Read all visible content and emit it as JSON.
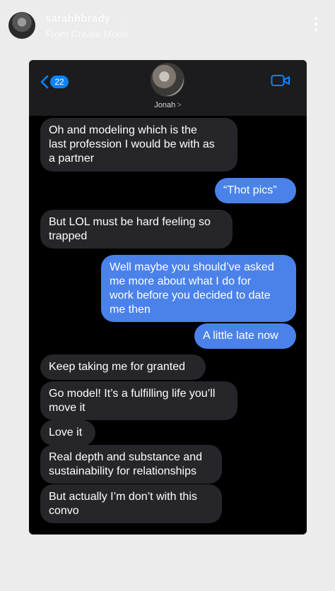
{
  "story": {
    "username": "sarahhbrady",
    "time": "6h",
    "subtitle": "From Create Mode",
    "more_icon": "more-vertical-icon"
  },
  "conversation": {
    "back_count": "22",
    "contact_name": "Jonah",
    "contact_chevron": ">",
    "accent_color": "#0a84ff",
    "sent_bubble_color": "#4a82ea",
    "received_bubble_color": "#26252a",
    "messages": [
      {
        "from": "them",
        "text": "Oh and modeling which is the\nlast profession I would be with as\na partner"
      },
      {
        "from": "me",
        "text": "“Thot pics”"
      },
      {
        "from": "them",
        "text": "But LOL must be hard feeling so\ntrapped"
      },
      {
        "from": "me",
        "text": "Well maybe you should’ve asked\nme more about what I do for\nwork before you decided to date\nme then"
      },
      {
        "from": "me",
        "text": "A little late now"
      },
      {
        "from": "them",
        "text": "Keep taking me for granted"
      },
      {
        "from": "them",
        "text": "Go model! It’s a fulfilling life you’ll\nmove it"
      },
      {
        "from": "them",
        "text": "Love it"
      },
      {
        "from": "them",
        "text": "Real depth and substance and\nsustainability for relationships"
      },
      {
        "from": "them",
        "text": "But actually I’m don’t with this\nconvo"
      }
    ]
  }
}
